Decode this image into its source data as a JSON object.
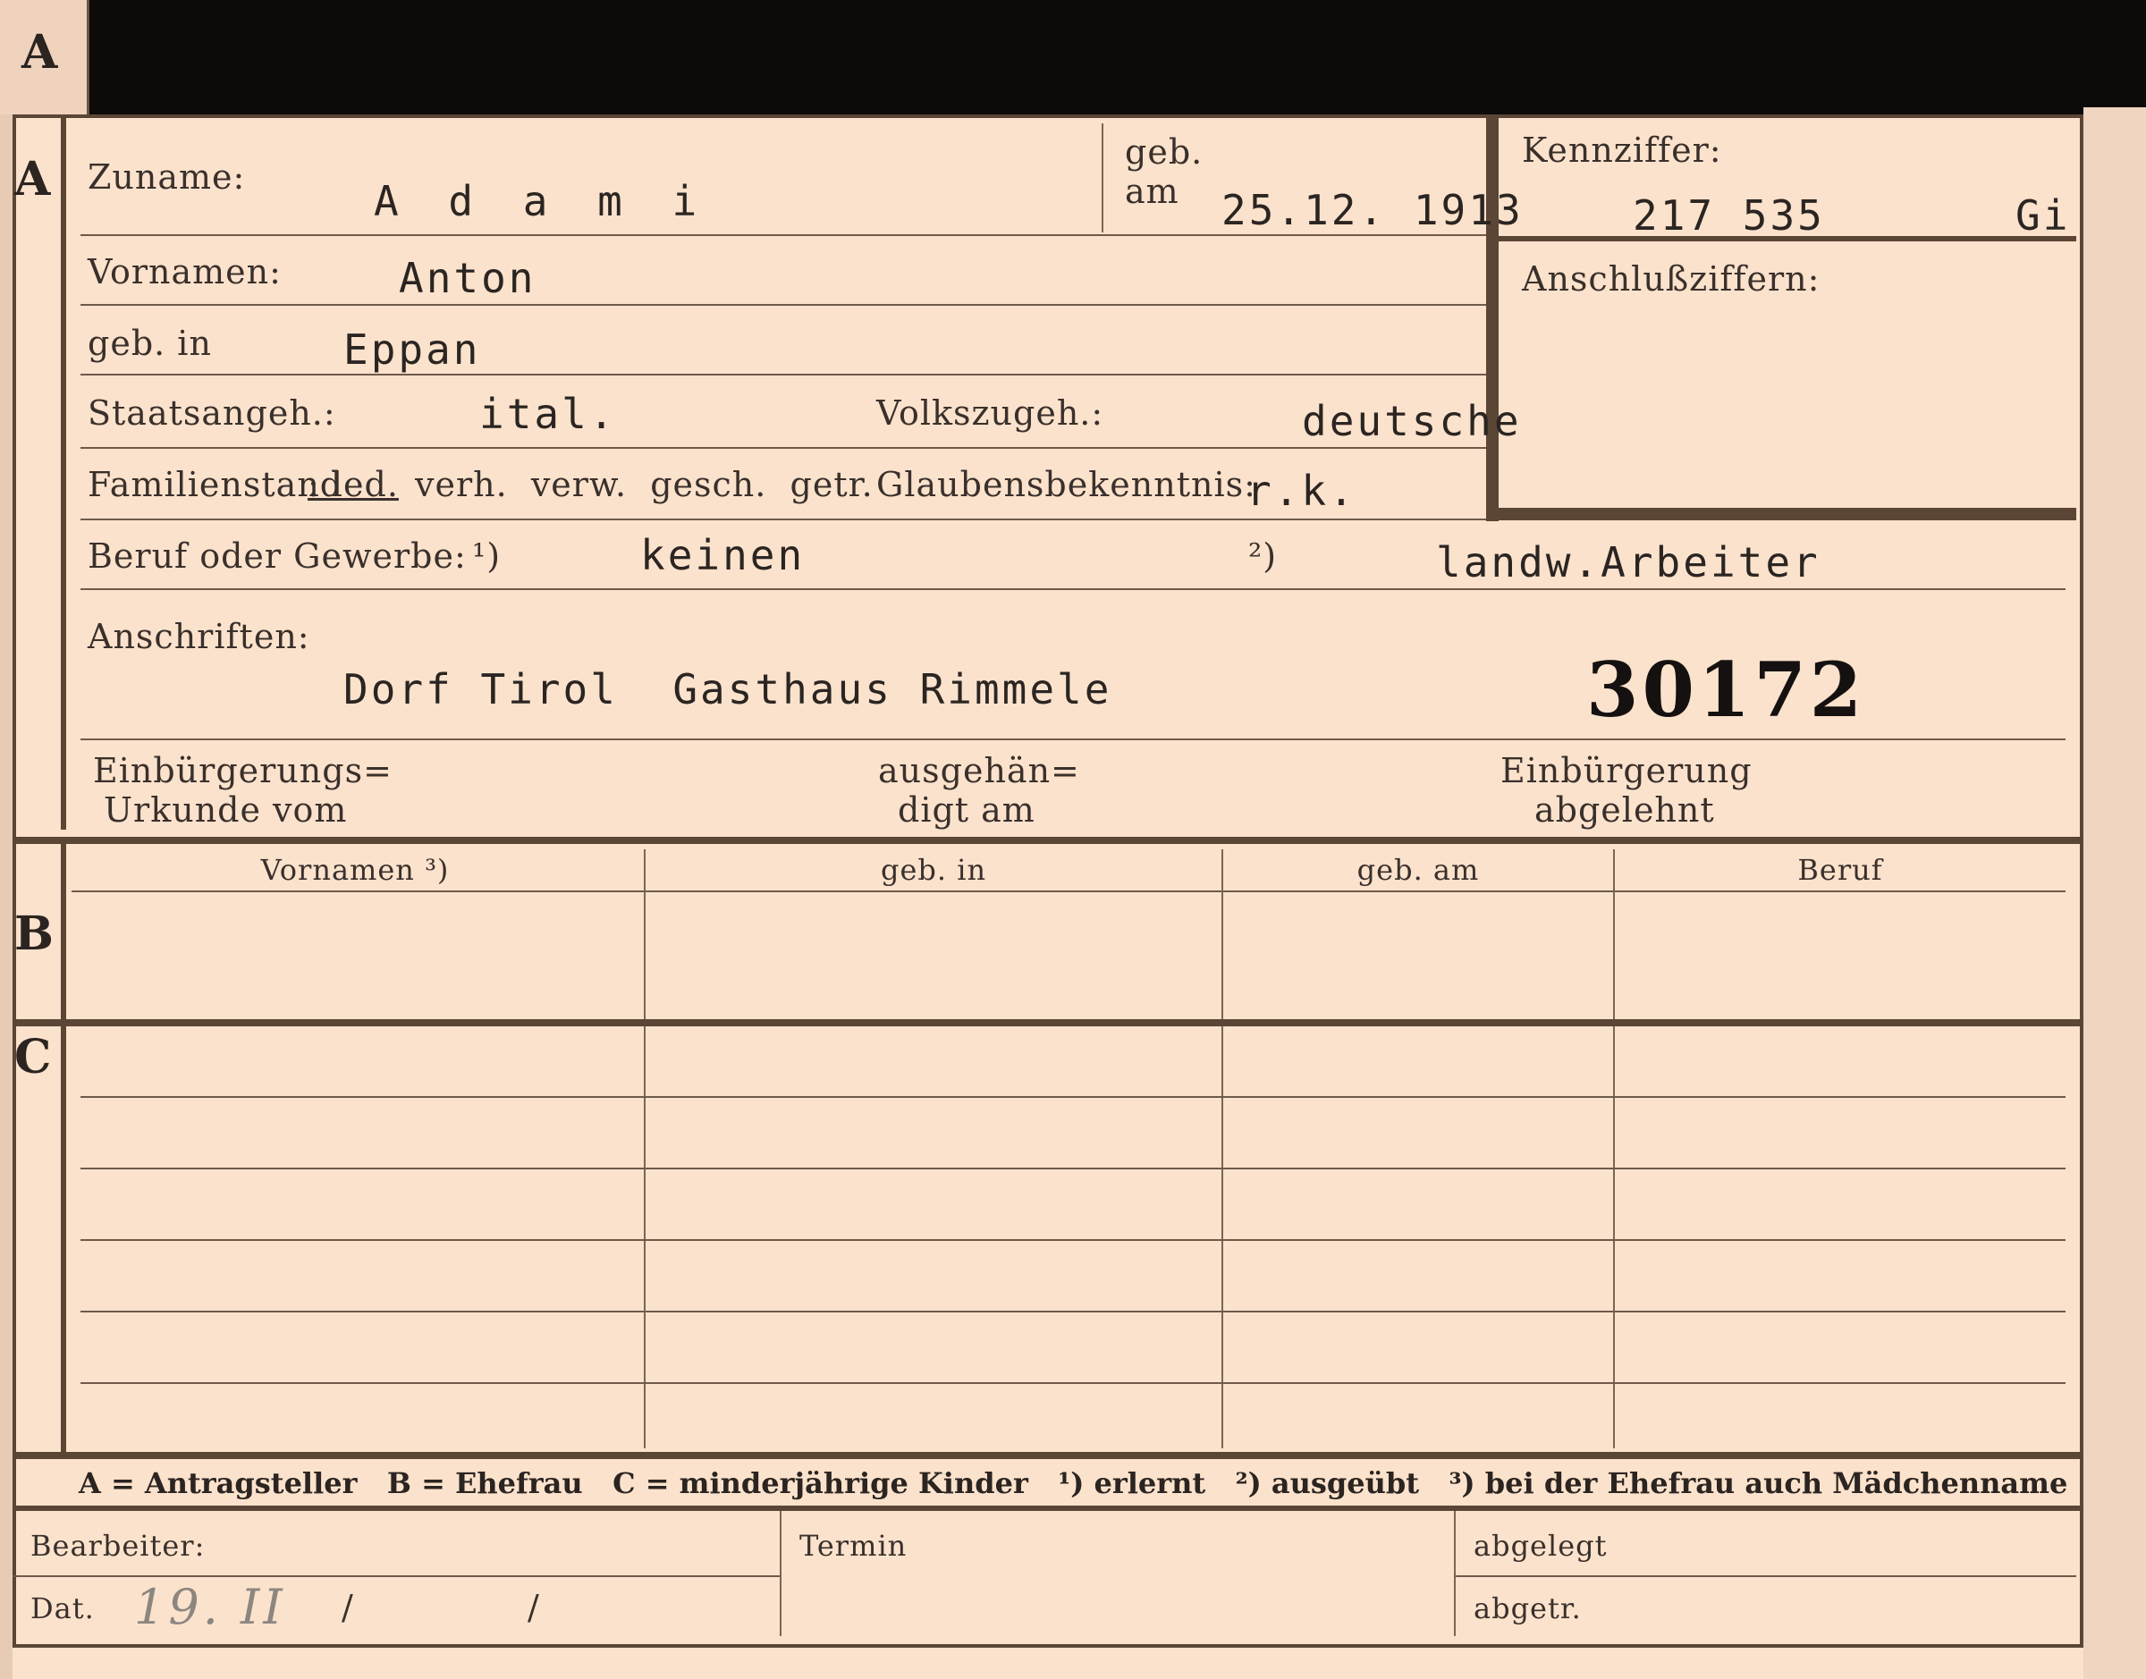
{
  "card": {
    "tab_letter": "A",
    "sections": {
      "a": "A",
      "b": "B",
      "c": "C"
    }
  },
  "applicant": {
    "surname_label": "Zuname:",
    "surname": "A d a m i",
    "born_on_label_1": "geb.",
    "born_on_label_2": "am",
    "born_on": "25.12. 1913",
    "reference_label": "Kennziffer:",
    "reference_number": "217 535",
    "reference_suffix": "Gi",
    "connection_numbers_label": "Anschlußziffern:",
    "first_names_label": "Vornamen:",
    "first_names": "Anton",
    "birthplace_label": "geb. in",
    "birthplace": "Eppan",
    "citizenship_label": "Staatsangeh.:",
    "citizenship": "ital.",
    "ethnicity_label": "Volkszugeh.:",
    "ethnicity": "deutsche",
    "marital_label": "Familienstand",
    "marital_selected": ": led.",
    "marital_options": "verh.  verw.  gesch.  getr.",
    "religion_label": "Glaubensbekenntnis:",
    "religion": "r.k.",
    "occupation_label": "Beruf oder Gewerbe:",
    "occupation_mark_1": "¹)",
    "occupation_learned": "keinen",
    "occupation_mark_2": "²)",
    "occupation_practiced": "landw.Arbeiter",
    "addresses_label": "Anschriften:",
    "address": "Dorf Tirol  Gasthaus Rimmele",
    "file_number": "30172",
    "naturalization_cert_label_1": "Einbürgerungs=",
    "naturalization_cert_label_2": "Urkunde vom",
    "handed_out_label_1": "ausgehän=",
    "handed_out_label_2": "digt am",
    "naturalization_rejected_label_1": "Einbürgerung",
    "naturalization_rejected_label_2": "abgelehnt"
  },
  "spouse_table": {
    "headers": [
      "Vornamen ³)",
      "geb. in",
      "geb. am",
      "Beruf"
    ]
  },
  "legend": {
    "text": "A = Antragsteller   B = Ehefrau   C = minderjährige Kinder   ¹) erlernt   ²) ausgeübt   ³) bei der Ehefrau auch Mädchenname"
  },
  "footer": {
    "clerk_label": "Bearbeiter:",
    "date_label": "Dat.",
    "date_handwritten": "19. II",
    "date_slash_1": "/",
    "date_slash_2": "/",
    "deadline_label": "Termin",
    "filed_label": "abgelegt",
    "detached_label": "abgetr."
  }
}
